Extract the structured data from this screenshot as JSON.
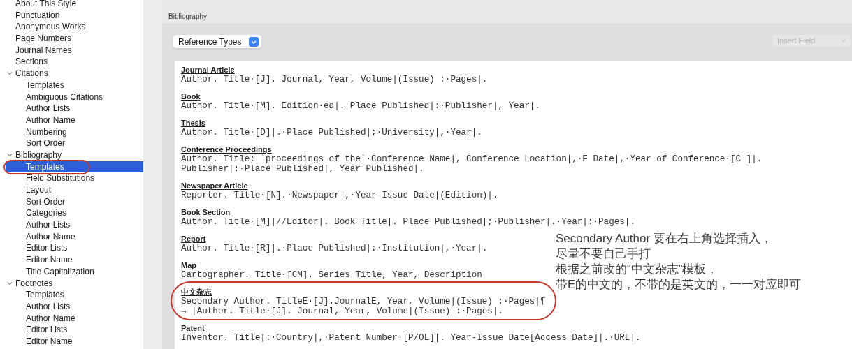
{
  "sidebar": {
    "items": [
      {
        "label": "About This Style",
        "selected": false
      },
      {
        "label": "Punctuation",
        "selected": false
      },
      {
        "label": "Anonymous Works",
        "selected": false
      },
      {
        "label": "Page Numbers",
        "selected": false
      },
      {
        "label": "Journal Names",
        "selected": false
      },
      {
        "label": "Sections",
        "selected": false
      },
      {
        "label": "Citations",
        "selected": false,
        "expanded": true,
        "children": [
          {
            "label": "Templates",
            "selected": false
          },
          {
            "label": "Ambiguous Citations",
            "selected": false
          },
          {
            "label": "Author Lists",
            "selected": false
          },
          {
            "label": "Author Name",
            "selected": false
          },
          {
            "label": "Numbering",
            "selected": false
          },
          {
            "label": "Sort Order",
            "selected": false
          }
        ]
      },
      {
        "label": "Bibliography",
        "selected": false,
        "expanded": true,
        "children": [
          {
            "label": "Templates",
            "selected": true
          },
          {
            "label": "Field Substitutions",
            "selected": false
          },
          {
            "label": "Layout",
            "selected": false
          },
          {
            "label": "Sort Order",
            "selected": false
          },
          {
            "label": "Categories",
            "selected": false
          },
          {
            "label": "Author Lists",
            "selected": false
          },
          {
            "label": "Author Name",
            "selected": false
          },
          {
            "label": "Editor Lists",
            "selected": false
          },
          {
            "label": "Editor Name",
            "selected": false
          },
          {
            "label": "Title Capitalization",
            "selected": false
          }
        ]
      },
      {
        "label": "Footnotes",
        "selected": false,
        "expanded": true,
        "children": [
          {
            "label": "Templates",
            "selected": false
          },
          {
            "label": "Author Lists",
            "selected": false
          },
          {
            "label": "Author Name",
            "selected": false
          },
          {
            "label": "Editor Lists",
            "selected": false
          },
          {
            "label": "Editor Name",
            "selected": false
          }
        ]
      }
    ]
  },
  "section_title": "Bibliography",
  "toolbar": {
    "reference_types": "Reference Types",
    "insert_field": {
      "label": "Insert Field",
      "disabled": true
    }
  },
  "templates": [
    {
      "name": "Journal Article",
      "lines": [
        "Author. Title·[J]. Journal, Year, Volume|(Issue) :·Pages|."
      ]
    },
    {
      "name": "Book",
      "lines": [
        "Author. Title·[M]. Edition·ed|. Place Published|:·Publisher|, Year|."
      ]
    },
    {
      "name": "Thesis",
      "lines": [
        "Author. Title·[D]|.·Place Published|;·University|,·Year|."
      ]
    },
    {
      "name": "Conference Proceedings",
      "lines": [
        "Author. Title; `proceedings of the`·Conference Name|, Conference Location|,·F Date|,·Year of Conference·[C ]|. Publisher|:·Place Published|, Year Published|."
      ]
    },
    {
      "name": "Newspaper Article",
      "lines": [
        "Reporter. Title·[N].·Newspaper|,·Year-Issue Date|(Edition)|."
      ]
    },
    {
      "name": "Book Section",
      "lines": [
        "Author. Title·[M]|//Editor|. Book Title|. Place Published|;·Publisher|.·Year|:·Pages|."
      ]
    },
    {
      "name": "Report",
      "lines": [
        "Author. Title·[R]|.·Place Published|:·Institution|,·Year|."
      ]
    },
    {
      "name": "Map",
      "lines": [
        "Cartographer. Title·[CM]. Series Title, Year, Description"
      ]
    },
    {
      "name": "中文杂志",
      "lines": [
        "Secondary Author. TitleE·[J].JournalE, Year, Volume|(Issue) :·Pages|¶",
        "→ |Author. Title·[J]. Journal, Year, Volume|(Issue) :·Pages|."
      ]
    },
    {
      "name": "Patent",
      "lines": [
        "Inventor. Title|:·Country|,·Patent Number·[P/OL]|. Year-Issue Date[Access Date]|.·URL|."
      ]
    }
  ],
  "annotation": {
    "lines": [
      "Secondary Author 要在右上角选择插入，",
      "尽量不要自己手打",
      "根据之前改的“中文杂志”模板，",
      "带E的中文的，不带的是英文的，一一对应即可"
    ]
  }
}
